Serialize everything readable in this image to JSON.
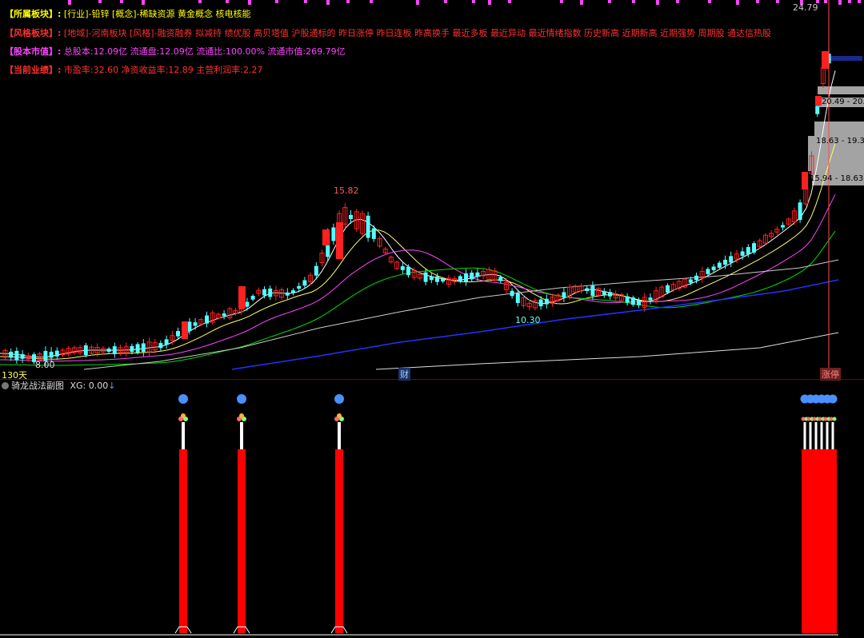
{
  "info": {
    "sector": {
      "label": "【所属板块】:",
      "content": "[行业]-铅锌 [概念]-稀缺资源 黄金概念 核电核能",
      "label_color": "#ffff00",
      "content_color": "#ffff00"
    },
    "style": {
      "label": "【风格板块】:",
      "content": "[地域]-河南板块 [风格]-融资融券 拟减持 绩优股 高贝塔值 沪股通标的 昨日涨停 昨日连板 昨高换手 最近多板 最近异动 最近情绪指数 历史新高 近期新高 近期强势 周期股 通达信热股",
      "label_color": "#ff3030",
      "content_color": "#ff3030"
    },
    "capital": {
      "label": "【股本市值】:",
      "content": "总股本:12.09亿 流通盘:12.09亿 流通比:100.00% 流通市值:269.79亿",
      "label_color": "#ff44ff",
      "content_color": "#ff44ff"
    },
    "performance": {
      "label": "【当前业绩】:",
      "content": "市盈率:32.60 净资收益率:12.89 主营利润率:2.27",
      "label_color": "#ff3030",
      "content_color": "#ff3030"
    }
  },
  "main_chart": {
    "price_labels": {
      "high_24": "24.79",
      "high_15": "15.82",
      "low_10": "10.30",
      "low_8": "8.00",
      "range_1": "20.49 - 20.",
      "range_2": "18.63 - 19.3",
      "range_3": "15.94 - 18.63"
    },
    "period_label": "130天",
    "finance_marker": "财",
    "limit_marker": "涨停",
    "colors": {
      "up": "#ff2020",
      "down": "#54ffff",
      "ma5": "#ffffff",
      "ma10": "#ffff66",
      "ma20": "#ff44ff",
      "ma30": "#00dd00",
      "ma60": "#cccccc",
      "ma120": "#2233ff",
      "ma250": "#dddddd",
      "volume_profile": "#c0c0c0"
    }
  },
  "sub_chart": {
    "title": "骑龙战法副图",
    "indicator": "XG: 0.00",
    "signal_color": "#ff0000",
    "dot_color": "#4a90ff"
  }
}
